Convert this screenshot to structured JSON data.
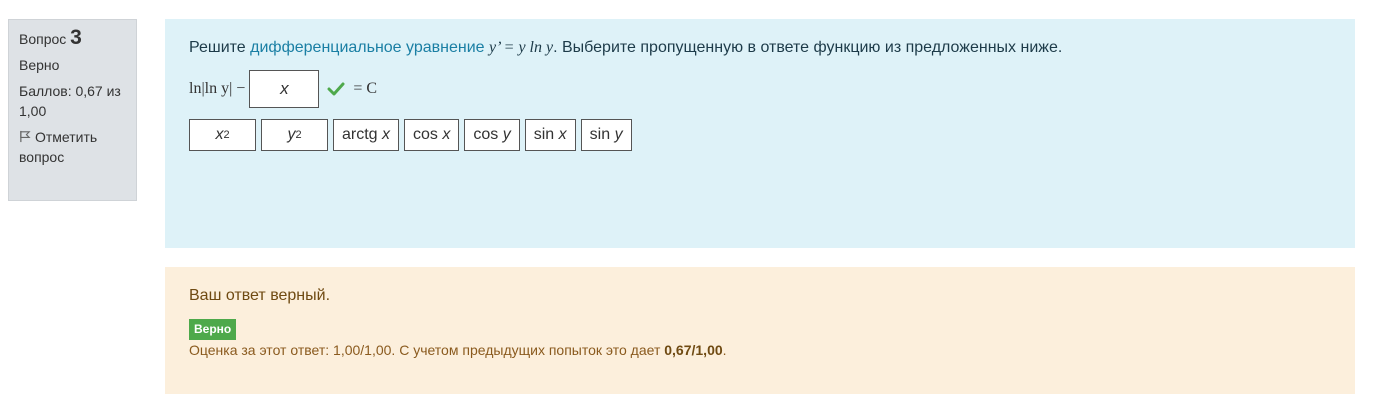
{
  "info": {
    "question_word": "Вопрос",
    "question_number": "3",
    "state": "Верно",
    "grade_label": "Баллов: 0,67 из 1,00",
    "flag_label": "Отметить вопрос"
  },
  "question": {
    "prefix": "Решите ",
    "link_text": "дифференциальное уравнение",
    "equation": "y’ = y ln y",
    "suffix": ". Выберите пропущенную в ответе функцию из предложенных ниже."
  },
  "answer": {
    "left_expr": "ln|ln y| −",
    "dropped_value": "x",
    "right_expr": "= C"
  },
  "choices": [
    {
      "base": "x",
      "sup": "2"
    },
    {
      "base": "y",
      "sup": "2"
    },
    {
      "fn": "arctg",
      "arg": "x"
    },
    {
      "fn": "cos",
      "arg": "x"
    },
    {
      "fn": "cos",
      "arg": "y"
    },
    {
      "fn": "sin",
      "arg": "x"
    },
    {
      "fn": "sin",
      "arg": "y"
    }
  ],
  "feedback": {
    "text": "Ваш ответ верный.",
    "badge": "Верно",
    "grade_prefix": "Оценка за этот ответ: 1,00/1,00. С учетом предыдущих попыток это дает ",
    "grade_value": "0,67/1,00",
    "grade_suffix": "."
  },
  "colors": {
    "info_bg": "#dee2e6",
    "question_bg": "#def2f8",
    "feedback_bg": "#fcefdc",
    "correct_green": "#4ea94b",
    "link": "#1a7fa4"
  }
}
